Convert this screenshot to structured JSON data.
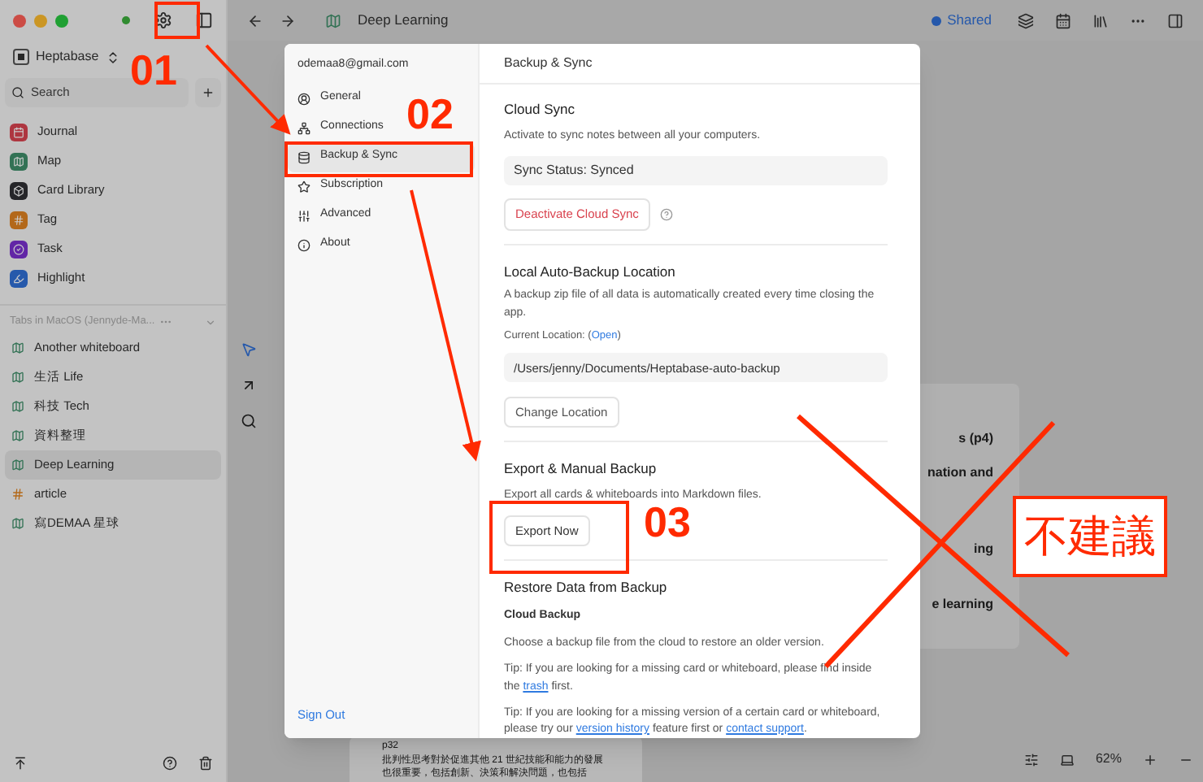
{
  "sidebar": {
    "workspace": "Heptabase",
    "search_placeholder": "Search",
    "items": [
      {
        "label": "Journal",
        "kind": "journal",
        "color": "#ae3640"
      },
      {
        "label": "Map",
        "kind": "map",
        "color": "#327255"
      },
      {
        "label": "Card Library",
        "kind": "library",
        "color": "#262629"
      },
      {
        "label": "Tag",
        "kind": "tag",
        "color": "#b3681a"
      },
      {
        "label": "Task",
        "kind": "task",
        "color": "#6226a6"
      },
      {
        "label": "Highlight",
        "kind": "highlight",
        "color": "#2659ab"
      }
    ],
    "tabs_header": "Tabs in MacOS (Jennyde-Ma...",
    "tabs": [
      {
        "label": "Another whiteboard",
        "kind": "whiteboard",
        "selected": false
      },
      {
        "label": "生活 Life",
        "kind": "whiteboard",
        "selected": false
      },
      {
        "label": "科技 Tech",
        "kind": "whiteboard",
        "selected": false
      },
      {
        "label": "資料整理",
        "kind": "whiteboard",
        "selected": false
      },
      {
        "label": "Deep Learning",
        "kind": "whiteboard",
        "selected": true
      },
      {
        "label": "article",
        "kind": "tag",
        "selected": false
      },
      {
        "label": "寫DEMAA 星球",
        "kind": "whiteboard",
        "selected": false
      }
    ]
  },
  "toolbar": {
    "title": "Deep Learning",
    "shared": "Shared"
  },
  "canvas": {
    "card_lines": [
      "s (p4)",
      "nation and",
      "ing",
      "e learning"
    ],
    "bottom_card": {
      "page": "p32",
      "text": "批判性思考對於促進其他 21 世紀技能和能力的發展也很重要，包括創新、決策和解決問題，也包括"
    },
    "zoom": "62%"
  },
  "dialog": {
    "email": "odemaa8@gmail.com",
    "nav": [
      {
        "label": "General",
        "kind": "general",
        "selected": false
      },
      {
        "label": "Connections",
        "kind": "connections",
        "selected": false
      },
      {
        "label": "Backup & Sync",
        "kind": "backup",
        "selected": true
      },
      {
        "label": "Subscription",
        "kind": "subscription",
        "selected": false
      },
      {
        "label": "Advanced",
        "kind": "advanced",
        "selected": false
      },
      {
        "label": "About",
        "kind": "about",
        "selected": false
      }
    ],
    "sign_out": "Sign Out",
    "title": "Backup & Sync",
    "cloud_sync": {
      "heading": "Cloud Sync",
      "description": "Activate to sync notes between all your computers.",
      "status": "Sync Status: Synced",
      "button": "Deactivate Cloud Sync"
    },
    "local_backup": {
      "heading": "Local Auto-Backup Location",
      "description": "A backup zip file of all data is automatically created every time closing the app.",
      "current_label": "Current Location: (",
      "open_link": "Open",
      "current_end": ")",
      "path": "/Users/jenny/Documents/Heptabase-auto-backup",
      "button": "Change Location"
    },
    "export": {
      "heading": "Export & Manual Backup",
      "description": "Export all cards & whiteboards into Markdown files.",
      "button": "Export Now"
    },
    "restore": {
      "heading": "Restore Data from Backup",
      "subheading": "Cloud Backup",
      "description": "Choose a backup file from the cloud to restore an older version.",
      "tips": [
        [
          {
            "text": "Tip: If you are looking for a missing card or whiteboard, please find inside the ",
            "kind": "text"
          },
          {
            "text": "trash",
            "kind": "link"
          },
          {
            "text": " first.",
            "kind": "text"
          }
        ],
        [
          {
            "text": "Tip: If you are looking for a missing version of a certain card or whiteboard, please try our ",
            "kind": "text"
          },
          {
            "text": "version history",
            "kind": "link"
          },
          {
            "text": " feature first or ",
            "kind": "text"
          },
          {
            "text": "contact support",
            "kind": "link"
          },
          {
            "text": ".",
            "kind": "text"
          }
        ]
      ]
    }
  },
  "annotations": {
    "steps": [
      "01",
      "02",
      "03"
    ],
    "warning": "不建議"
  }
}
